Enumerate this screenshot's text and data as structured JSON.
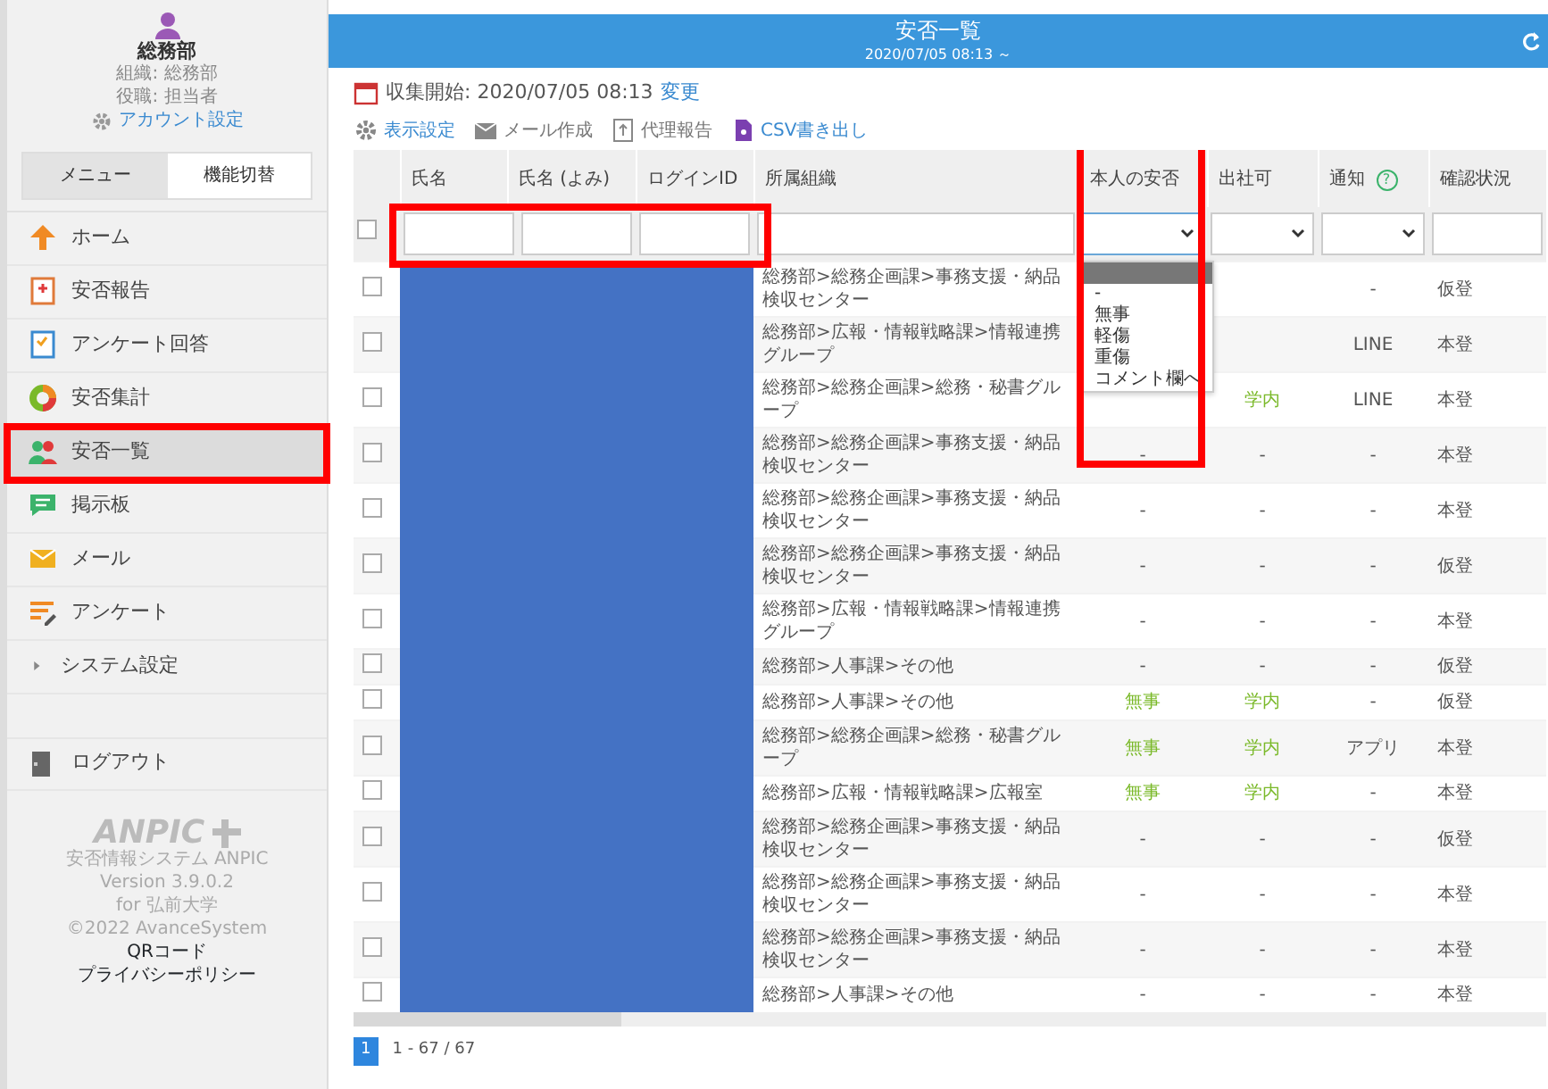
{
  "sidebar": {
    "user": {
      "name": "総務部",
      "org": "組織: 総務部",
      "role": "役職: 担当者"
    },
    "account_link": "アカウント設定",
    "tabs": [
      {
        "label": "メニュー",
        "selected": true
      },
      {
        "label": "機能切替",
        "selected": false
      }
    ],
    "menu": [
      {
        "label": "ホーム",
        "kind": "home",
        "selected": false,
        "annotated": false
      },
      {
        "label": "安否報告",
        "kind": "report",
        "selected": false,
        "annotated": false
      },
      {
        "label": "アンケート回答",
        "kind": "survey-answer",
        "selected": false,
        "annotated": false
      },
      {
        "label": "安否集計",
        "kind": "ring",
        "selected": false,
        "annotated": false
      },
      {
        "label": "安否一覧",
        "kind": "people",
        "selected": true,
        "annotated": true
      },
      {
        "label": "掲示板",
        "kind": "board",
        "selected": false,
        "annotated": false
      },
      {
        "label": "メール",
        "kind": "mail",
        "selected": false,
        "annotated": false
      },
      {
        "label": "アンケート",
        "kind": "survey",
        "selected": false,
        "annotated": false
      },
      {
        "label": "システム設定",
        "kind": "caret",
        "selected": false,
        "annotated": false
      }
    ],
    "logout": "ログアウト",
    "logo": "ANPIC",
    "footer": [
      "安否情報システム ANPIC",
      "Version 3.9.0.2",
      "for 弘前大学",
      "©2022 AvanceSystem"
    ],
    "links": [
      "QRコード",
      "プライバシーポリシー"
    ]
  },
  "main": {
    "title": "安否一覧",
    "subtitle": "2020/07/05 08:13 ～",
    "collect": {
      "label": "収集開始: 2020/07/05 08:13",
      "link": "変更"
    },
    "toolbar": [
      {
        "label": "表示設定",
        "kind": "gear",
        "link": true
      },
      {
        "label": "メール作成",
        "kind": "mail",
        "link": false
      },
      {
        "label": "代理報告",
        "kind": "proxy",
        "link": false
      },
      {
        "label": "CSV書き出し",
        "kind": "file",
        "link": true
      }
    ],
    "table": {
      "columns": [
        "氏名",
        "氏名 (よみ)",
        "ログインID",
        "所属組織",
        "本人の安否",
        "出社可",
        "通知",
        "確認状況"
      ],
      "help": "?",
      "select_all_checked": false,
      "dropdown": [
        {
          "selected": true
        },
        {
          "label": "-",
          "selected": false
        },
        {
          "label": "無事",
          "selected": false
        },
        {
          "label": "軽傷",
          "selected": false
        },
        {
          "label": "重傷",
          "selected": false
        },
        {
          "label": "コメント欄へ",
          "selected": false
        }
      ],
      "rows": [
        {
          "checked": false,
          "org": "総務部>総務企画課>事務支援・納品検収センター",
          "safety": null,
          "office": null,
          "notice": "-",
          "registration": "仮登"
        },
        {
          "checked": false,
          "org": "総務部>広報・情報戦略課>情報連携グループ",
          "safety": null,
          "office": null,
          "notice": "LINE",
          "registration": "本登"
        },
        {
          "checked": false,
          "org": "総務部>総務企画課>総務・秘書グループ",
          "safety": null,
          "office": "学内",
          "notice": "LINE",
          "registration": "本登",
          "answered": true
        },
        {
          "checked": false,
          "org": "総務部>総務企画課>事務支援・納品検収センター",
          "safety": "-",
          "office": "-",
          "notice": "-",
          "registration": "本登",
          "answered": false
        },
        {
          "checked": false,
          "org": "総務部>総務企画課>事務支援・納品検収センター",
          "safety": "-",
          "office": "-",
          "notice": "-",
          "registration": "本登",
          "answered": false
        },
        {
          "checked": false,
          "org": "総務部>総務企画課>事務支援・納品検収センター",
          "safety": "-",
          "office": "-",
          "notice": "-",
          "registration": "仮登",
          "answered": false
        },
        {
          "checked": false,
          "org": "総務部>広報・情報戦略課>情報連携グループ",
          "safety": "-",
          "office": "-",
          "notice": "-",
          "registration": "本登",
          "answered": false
        },
        {
          "checked": false,
          "org": "総務部>人事課>その他",
          "safety": "-",
          "office": "-",
          "notice": "-",
          "registration": "仮登",
          "answered": false
        },
        {
          "checked": false,
          "org": "総務部>人事課>その他",
          "safety": "無事",
          "office": "学内",
          "notice": "-",
          "registration": "仮登",
          "answered": true
        },
        {
          "checked": false,
          "org": "総務部>総務企画課>総務・秘書グループ",
          "safety": "無事",
          "office": "学内",
          "notice": "アプリ",
          "registration": "本登",
          "answered": true
        },
        {
          "checked": false,
          "org": "総務部>広報・情報戦略課>広報室",
          "safety": "無事",
          "office": "学内",
          "notice": "-",
          "registration": "本登",
          "answered": true
        },
        {
          "checked": false,
          "org": "総務部>総務企画課>事務支援・納品検収センター",
          "safety": "-",
          "office": "-",
          "notice": "-",
          "registration": "仮登",
          "answered": false
        },
        {
          "checked": false,
          "org": "総務部>総務企画課>事務支援・納品検収センター",
          "safety": "-",
          "office": "-",
          "notice": "-",
          "registration": "本登",
          "answered": false
        },
        {
          "checked": false,
          "org": "総務部>総務企画課>事務支援・納品検収センター",
          "safety": "-",
          "office": "-",
          "notice": "-",
          "registration": "本登",
          "answered": false
        },
        {
          "checked": false,
          "org": "総務部>人事課>その他",
          "safety": "-",
          "office": "-",
          "notice": "-",
          "registration": "本登",
          "answered": false
        }
      ]
    },
    "pagination": {
      "page": "1",
      "summary": "1 - 67 / 67"
    }
  }
}
